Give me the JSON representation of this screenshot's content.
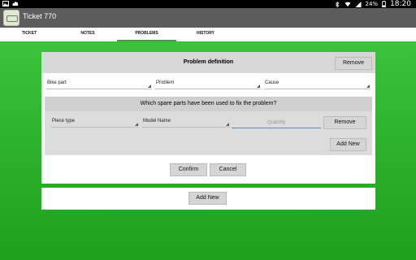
{
  "status_bar": {
    "battery": "24%",
    "time": "18:20",
    "icons": [
      "image-icon",
      "cloud-upload-icon",
      "bluetooth-icon",
      "wifi-icon",
      "signal-icon",
      "battery-icon"
    ]
  },
  "app": {
    "title": "Ticket 770",
    "icon": "bike-ticket-icon"
  },
  "tabs": [
    {
      "label": "TICKET",
      "active": false
    },
    {
      "label": "NOTES",
      "active": false
    },
    {
      "label": "PROBLEMS",
      "active": true
    },
    {
      "label": "HISTORY",
      "active": false
    }
  ],
  "problem": {
    "title": "Problem definition",
    "remove_label": "Remove",
    "spinners": {
      "bike_part": "Bike part",
      "problem": "Problem",
      "cause": "Cause"
    },
    "spare_parts": {
      "question": "Which spare parts have been used to fix the problem?",
      "piece_type": "Piece type",
      "model_name": "Model Name",
      "quantity_placeholder": "Quantity",
      "remove_label": "Remove",
      "add_new_label": "Add New"
    },
    "confirm_label": "Confirm",
    "cancel_label": "Cancel"
  },
  "add_new_label": "Add New",
  "colors": {
    "accent": "#2bb02b",
    "action_bar": "#5c5c5c",
    "tab_indicator": "#4a9a4a"
  }
}
